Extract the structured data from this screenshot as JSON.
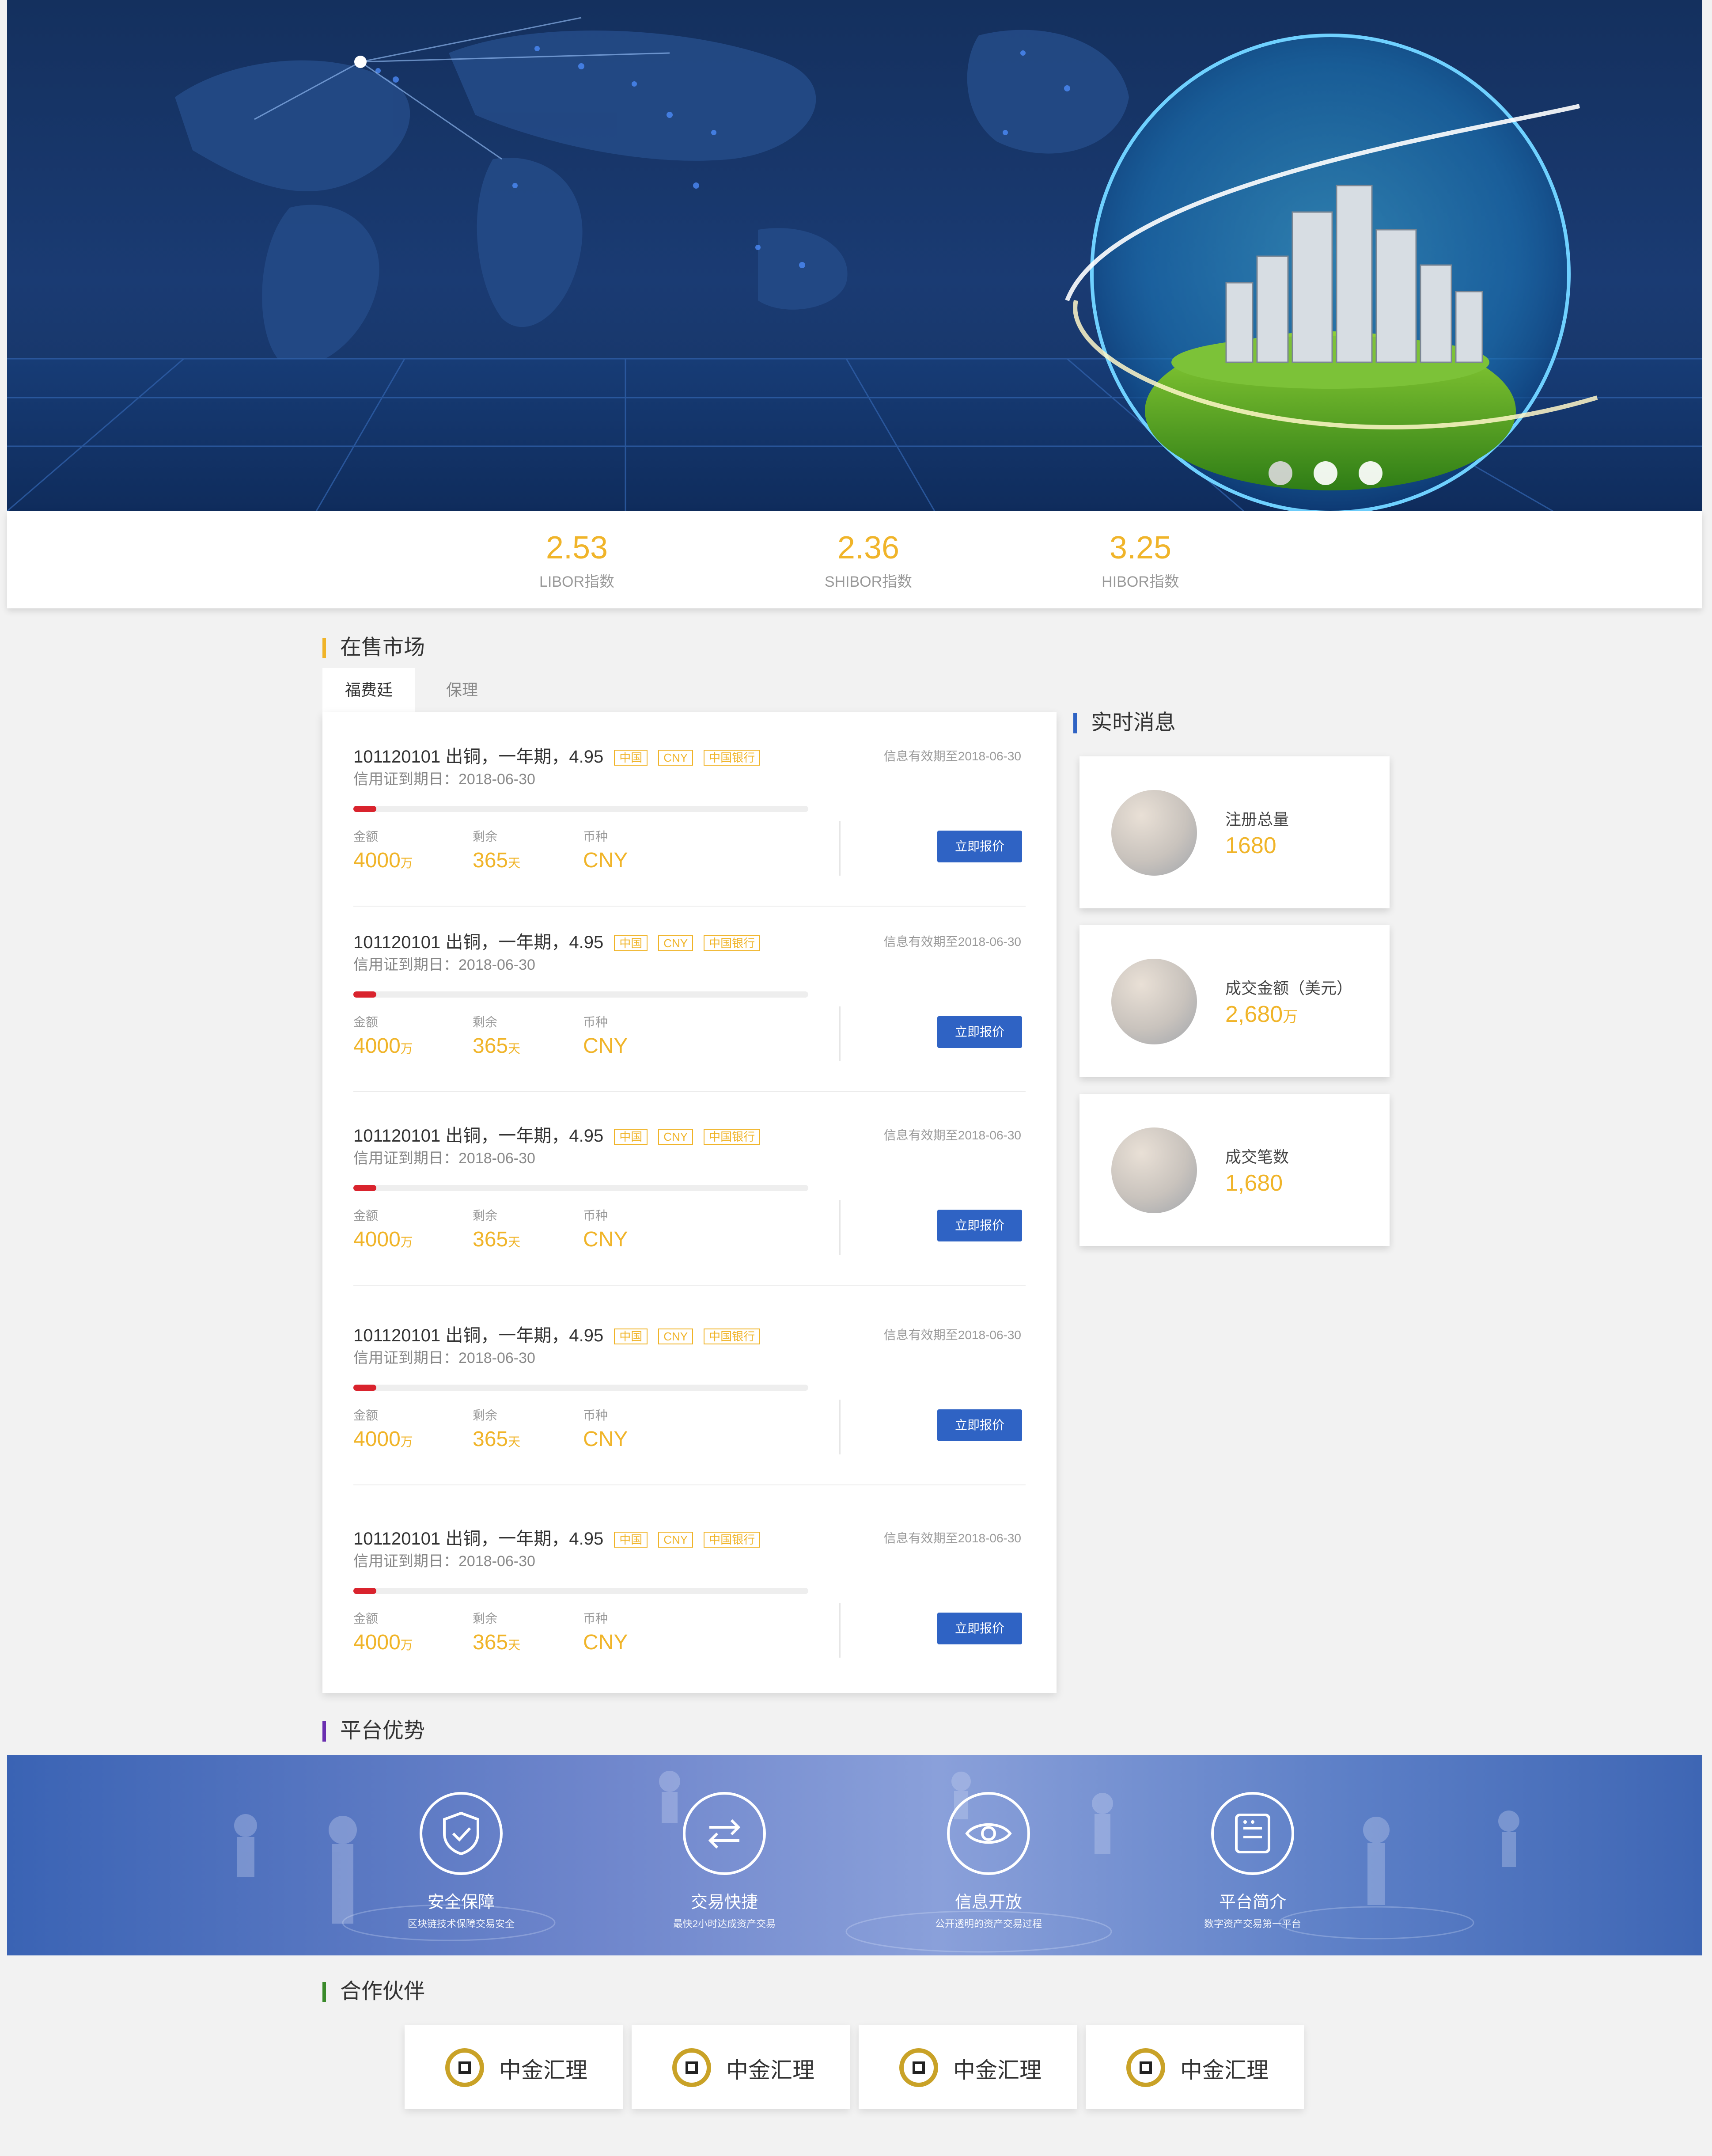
{
  "hero": {
    "slide_count": 3,
    "active_slide": 1
  },
  "rates": [
    {
      "value": "2.53",
      "label": "LIBOR指数"
    },
    {
      "value": "2.36",
      "label": "SHIBOR指数"
    },
    {
      "value": "3.25",
      "label": "HIBOR指数"
    }
  ],
  "sections": {
    "market_title": "在售市场",
    "news_title": "实时消息",
    "advantage_title": "平台优势",
    "partner_title": "合作伙伴"
  },
  "tabs": [
    "福费廷",
    "保理"
  ],
  "listings": [
    {
      "title": "101120101 出铜，一年期，4.95",
      "tags": [
        "中国",
        "CNY",
        "中国银行"
      ],
      "expiry": "信用证到期日：2018-06-30",
      "valid": "信息有效期至2018-06-30",
      "progress": 0.05,
      "amount_label": "金额",
      "amount": "4000",
      "amount_unit": "万",
      "remain_label": "剩余",
      "remain": "365",
      "remain_unit": "天",
      "currency_label": "币种",
      "currency": "CNY",
      "button": "立即报价"
    },
    {
      "title": "101120101 出铜，一年期，4.95",
      "tags": [
        "中国",
        "CNY",
        "中国银行"
      ],
      "expiry": "信用证到期日：2018-06-30",
      "valid": "信息有效期至2018-06-30",
      "progress": 0.05,
      "amount_label": "金额",
      "amount": "4000",
      "amount_unit": "万",
      "remain_label": "剩余",
      "remain": "365",
      "remain_unit": "天",
      "currency_label": "币种",
      "currency": "CNY",
      "button": "立即报价"
    },
    {
      "title": "101120101 出铜，一年期，4.95",
      "tags": [
        "中国",
        "CNY",
        "中国银行"
      ],
      "expiry": "信用证到期日：2018-06-30",
      "valid": "信息有效期至2018-06-30",
      "progress": 0.05,
      "amount_label": "金额",
      "amount": "4000",
      "amount_unit": "万",
      "remain_label": "剩余",
      "remain": "365",
      "remain_unit": "天",
      "currency_label": "币种",
      "currency": "CNY",
      "button": "立即报价"
    },
    {
      "title": "101120101 出铜，一年期，4.95",
      "tags": [
        "中国",
        "CNY",
        "中国银行"
      ],
      "expiry": "信用证到期日：2018-06-30",
      "valid": "信息有效期至2018-06-30",
      "progress": 0.05,
      "amount_label": "金额",
      "amount": "4000",
      "amount_unit": "万",
      "remain_label": "剩余",
      "remain": "365",
      "remain_unit": "天",
      "currency_label": "币种",
      "currency": "CNY",
      "button": "立即报价"
    },
    {
      "title": "101120101 出铜，一年期，4.95",
      "tags": [
        "中国",
        "CNY",
        "中国银行"
      ],
      "expiry": "信用证到期日：2018-06-30",
      "valid": "信息有效期至2018-06-30",
      "progress": 0.05,
      "amount_label": "金额",
      "amount": "4000",
      "amount_unit": "万",
      "remain_label": "剩余",
      "remain": "365",
      "remain_unit": "天",
      "currency_label": "币种",
      "currency": "CNY",
      "button": "立即报价"
    }
  ],
  "news": [
    {
      "label": "注册总量",
      "value": "1680",
      "unit": ""
    },
    {
      "label": "成交金额（美元）",
      "value": "2,680",
      "unit": "万"
    },
    {
      "label": "成交笔数",
      "value": "1,680",
      "unit": ""
    }
  ],
  "advantages": [
    {
      "icon": "shield-check-icon",
      "title": "安全保障",
      "desc": "区块链技术保障交易安全"
    },
    {
      "icon": "exchange-arrows-icon",
      "title": "交易快捷",
      "desc": "最快2小时达成资产交易"
    },
    {
      "icon": "eye-icon",
      "title": "信息开放",
      "desc": "公开透明的资产交易过程"
    },
    {
      "icon": "document-icon",
      "title": "平台简介",
      "desc": "数字资产交易第一平台"
    }
  ],
  "partners": [
    {
      "name": "中金汇理"
    },
    {
      "name": "中金汇理"
    },
    {
      "name": "中金汇理"
    },
    {
      "name": "中金汇理"
    }
  ],
  "colors": {
    "accent_yellow": "#f0b429",
    "button_blue": "#2f63c4",
    "progress_red": "#d9232d",
    "bar_market": "#f0b429",
    "bar_news": "#2f63c4",
    "bar_advantage": "#6a2fb0",
    "bar_partner": "#3a8a2a"
  }
}
